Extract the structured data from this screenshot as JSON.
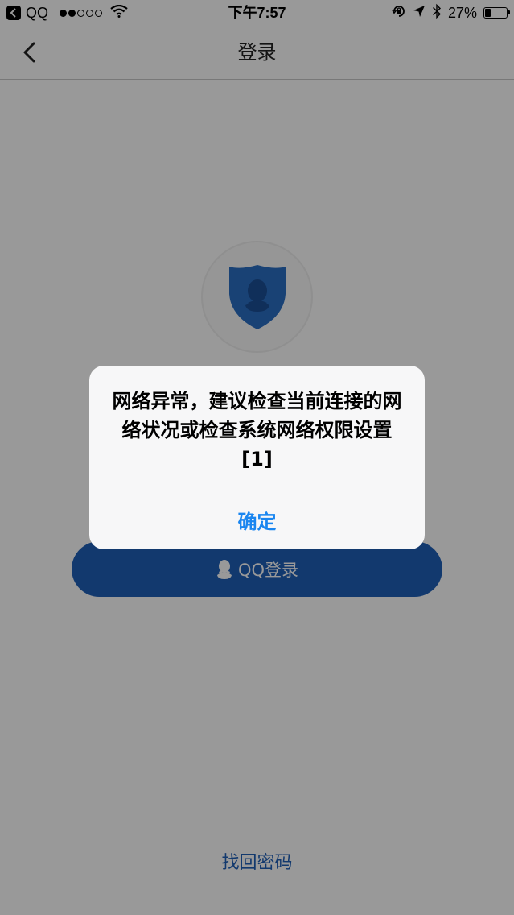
{
  "status_bar": {
    "back_app": "QQ",
    "time": "下午7:57",
    "battery": "27%",
    "icons": [
      "back-arrow-icon",
      "signal-dots-icon",
      "wifi-icon",
      "lock-rotation-icon",
      "location-arrow-icon",
      "bluetooth-icon",
      "battery-icon"
    ]
  },
  "nav": {
    "title": "登录",
    "back_icon": "chevron-left-icon"
  },
  "main": {
    "logo_icon": "qq-shield-icon",
    "login_button": "QQ登录",
    "login_icon": "qq-penguin-icon",
    "find_password": "找回密码"
  },
  "alert": {
    "message": "网络异常，建议检查当前连接的网络状况或检查系统网络权限设置 [1]",
    "ok_label": "确定"
  },
  "colors": {
    "brand_blue": "#1e5fb8",
    "alert_button_blue": "#1a86f0"
  }
}
